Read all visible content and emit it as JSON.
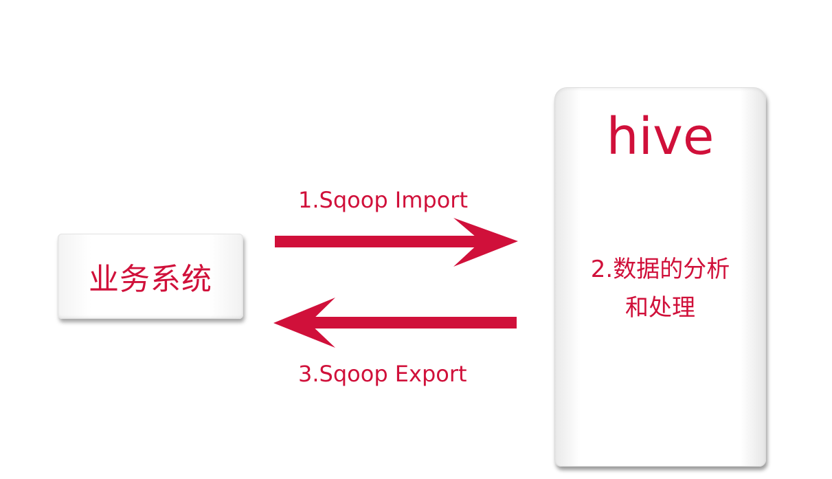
{
  "source_system": {
    "label": "业务系统"
  },
  "hive": {
    "title": "hive",
    "description_line1": "2.数据的分析",
    "description_line2": "和处理"
  },
  "flows": {
    "import_label": "1.Sqoop Import",
    "export_label": "3.Sqoop Export"
  },
  "colors": {
    "accent": "#d0103a"
  }
}
